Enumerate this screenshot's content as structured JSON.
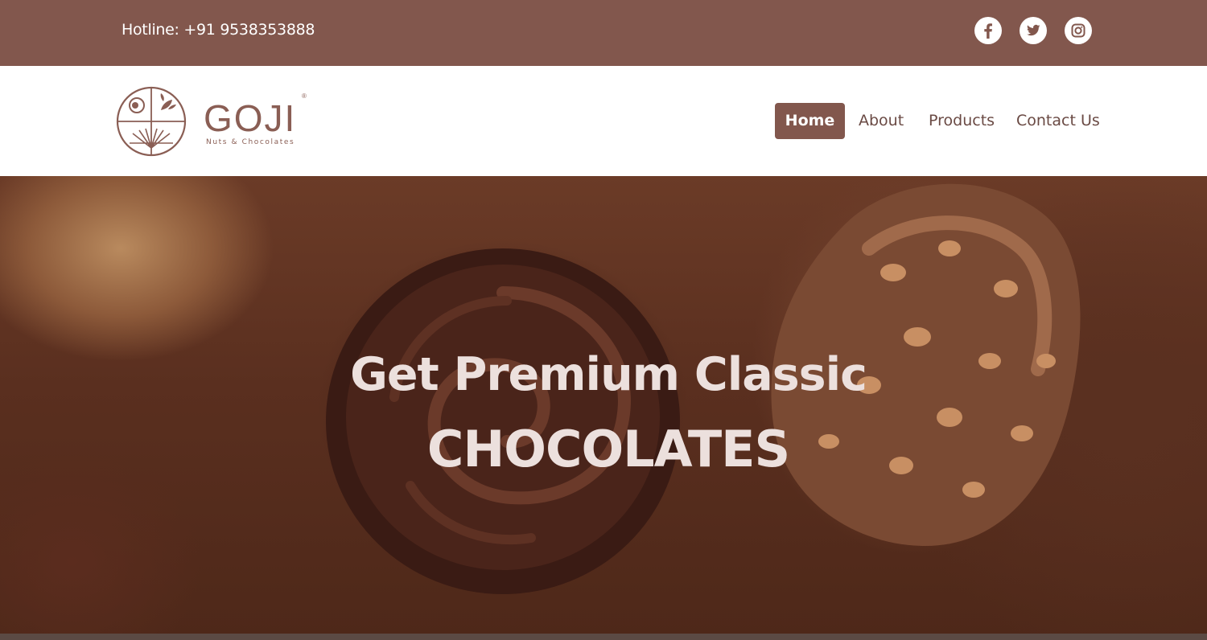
{
  "topbar": {
    "hotline": "Hotline: +91 9538353888",
    "social": [
      {
        "icon": "facebook-icon"
      },
      {
        "icon": "twitter-icon"
      },
      {
        "icon": "instagram-icon"
      }
    ]
  },
  "header": {
    "logo": {
      "word": "GOJI",
      "tagline": "Nuts & Chocolates",
      "registered": "®"
    },
    "nav": [
      {
        "label": "Home",
        "active": true
      },
      {
        "label": "About",
        "active": false
      },
      {
        "label": "Products",
        "active": false
      },
      {
        "label": "Contact Us",
        "active": false
      }
    ]
  },
  "hero": {
    "line1": "Get Premium Classic",
    "line2": "CHOCOLATES"
  },
  "colors": {
    "brand": "#82574d",
    "text_light": "#ece0dd"
  }
}
